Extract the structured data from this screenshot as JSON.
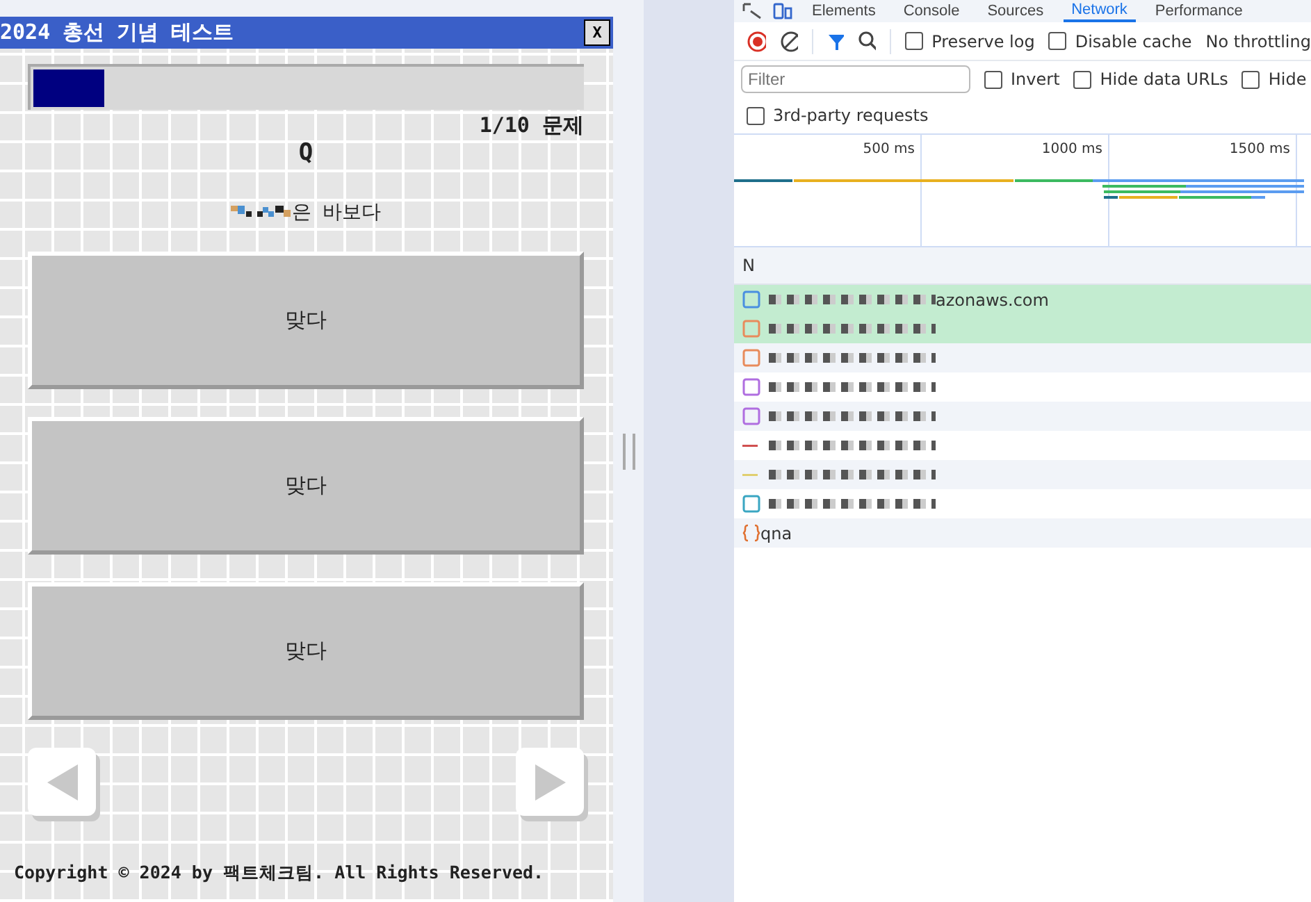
{
  "quiz": {
    "title": "2024 총선 기념 테스트",
    "close": "X",
    "progress": {
      "level": 0.13
    },
    "counter": "1/10 문제",
    "q_label": "Q",
    "question": "은 바보다",
    "question_redacted": true,
    "answers": [
      "맞다",
      "맞다",
      "맞다"
    ],
    "nav": [
      {
        "kind": "prev"
      },
      {
        "kind": "next"
      }
    ],
    "footer": "Copyright © 2024 by 팩트체크팀. All Rights Reserved."
  },
  "devtools": {
    "tabs": [
      {
        "label": "Elements",
        "selected": false
      },
      {
        "label": "Console",
        "selected": false
      },
      {
        "label": "Sources",
        "selected": false
      },
      {
        "label": "Network",
        "selected": true
      },
      {
        "label": "Performance",
        "selected": false
      }
    ],
    "recording": true,
    "checks": [
      {
        "label": "Preserve log",
        "checked": false
      },
      {
        "label": "Disable cache",
        "checked": false
      }
    ],
    "throttling": "No throttling",
    "filter": {
      "placeholder": "Filter"
    },
    "filter_checks": [
      {
        "label": "Invert",
        "checked": false
      },
      {
        "label": "Hide data URLs",
        "checked": false
      },
      {
        "label": "Hide",
        "checked": false
      }
    ],
    "third_party": {
      "label": "3rd-party requests",
      "checked": false
    },
    "ticks": [
      "500 ms",
      "1000 ms",
      "1500 ms"
    ],
    "name_header": "N",
    "rows": [
      {
        "kind": "document",
        "name": "azonaws.com",
        "highlighted": true
      },
      {
        "kind": "script",
        "name": "",
        "highlighted": true
      },
      {
        "kind": "script",
        "name": "",
        "highlighted": false
      },
      {
        "kind": "image",
        "name": "",
        "highlighted": false
      },
      {
        "kind": "image",
        "name": "",
        "highlighted": false
      },
      {
        "kind": "other",
        "name": "",
        "highlighted": false
      },
      {
        "kind": "style",
        "name": "",
        "highlighted": false
      },
      {
        "kind": "font",
        "name": "",
        "highlighted": false
      },
      {
        "kind": "fetch",
        "name": "qna",
        "highlighted": false
      }
    ]
  }
}
